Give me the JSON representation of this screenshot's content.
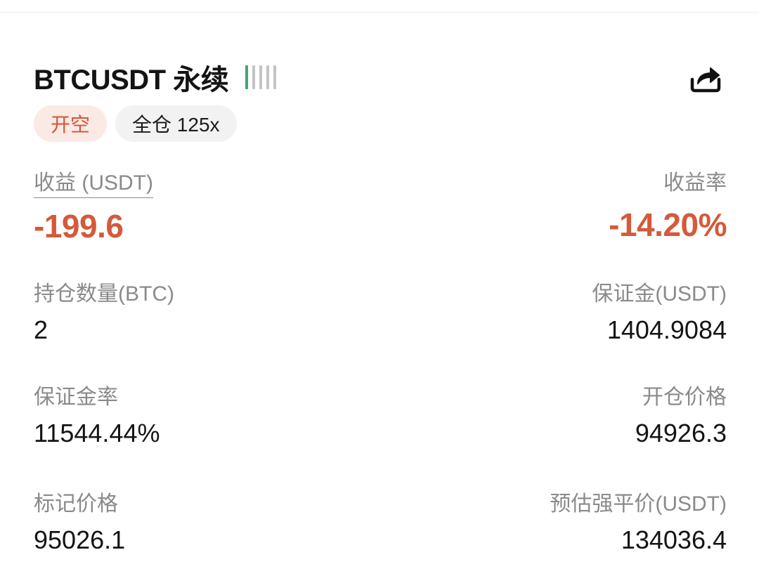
{
  "header": {
    "pair_title": "BTCUSDT 永续",
    "risk_level": 1,
    "risk_bars_total": 5,
    "share_icon": "share-icon"
  },
  "tags": {
    "side": "开空",
    "margin_mode": "全仓 125x"
  },
  "pnl": {
    "label": "收益 (USDT)",
    "value": "-199.6",
    "rate_label": "收益率",
    "rate_value": "-14.20%"
  },
  "position": {
    "size_label": "持仓数量(BTC)",
    "size_value": "2",
    "margin_label": "保证金(USDT)",
    "margin_value": "1404.9084"
  },
  "ratios": {
    "margin_ratio_label": "保证金率",
    "margin_ratio_value": "11544.44%",
    "entry_price_label": "开仓价格",
    "entry_price_value": "94926.3"
  },
  "prices": {
    "mark_price_label": "标记价格",
    "mark_price_value": "95026.1",
    "liq_price_label": "预估强平价(USDT)",
    "liq_price_value": "134036.4"
  },
  "colors": {
    "loss": "#d35a3b",
    "risk_active": "#3fa877",
    "risk_inactive": "#c4c4c4",
    "short_tag_bg": "#fbe9e4"
  }
}
